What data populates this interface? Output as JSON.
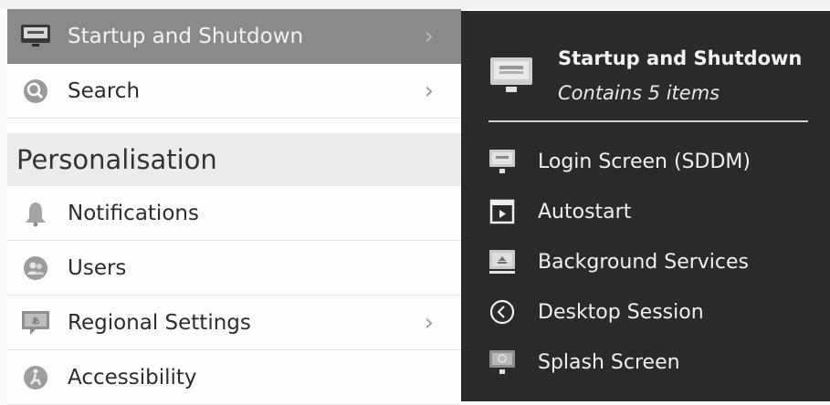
{
  "sidebar": {
    "items": [
      {
        "label": "Startup and Shutdown",
        "icon": "monitor-icon",
        "has_chevron": true,
        "selected": true
      },
      {
        "label": "Search",
        "icon": "search-icon",
        "has_chevron": true
      },
      {
        "label": "Notifications",
        "icon": "bell-icon",
        "has_chevron": false
      },
      {
        "label": "Users",
        "icon": "users-icon",
        "has_chevron": false
      },
      {
        "label": "Regional Settings",
        "icon": "regional-settings-icon",
        "has_chevron": true
      },
      {
        "label": "Accessibility",
        "icon": "accessibility-icon",
        "has_chevron": false
      }
    ],
    "section_header": "Personalisation",
    "chevron": "›"
  },
  "panel": {
    "title": "Startup and Shutdown",
    "subtitle": "Contains 5 items",
    "items": [
      {
        "label": "Login Screen (SDDM)",
        "icon": "login-screen-icon"
      },
      {
        "label": "Autostart",
        "icon": "autostart-icon"
      },
      {
        "label": "Background Services",
        "icon": "background-services-icon"
      },
      {
        "label": "Desktop Session",
        "icon": "desktop-session-icon"
      },
      {
        "label": "Splash Screen",
        "icon": "splash-screen-icon"
      }
    ]
  },
  "colors": {
    "selected_bg": "#8a8a8a",
    "panel_bg": "#2a2a2a",
    "section_bg": "#ececec"
  }
}
